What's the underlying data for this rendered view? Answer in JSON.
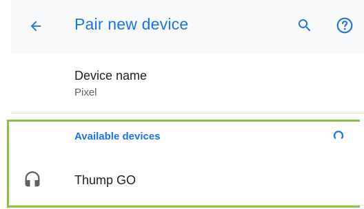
{
  "appbar": {
    "title": "Pair new device",
    "back_icon": "arrow-back-icon",
    "search_icon": "search-icon",
    "help_icon": "help-icon"
  },
  "device_name": {
    "title": "Device name",
    "value": "Pixel"
  },
  "available_devices": {
    "header": "Available devices",
    "spinner_icon": "loading-spinner-icon",
    "items": [
      {
        "label": "Thump GO",
        "icon": "headphones-icon"
      }
    ]
  },
  "colors": {
    "accent": "#1a73e8",
    "highlight": "#8bc34a",
    "appbar_bg": "#f8f9fa",
    "text_primary": "#202124",
    "text_secondary": "#5f6368"
  }
}
